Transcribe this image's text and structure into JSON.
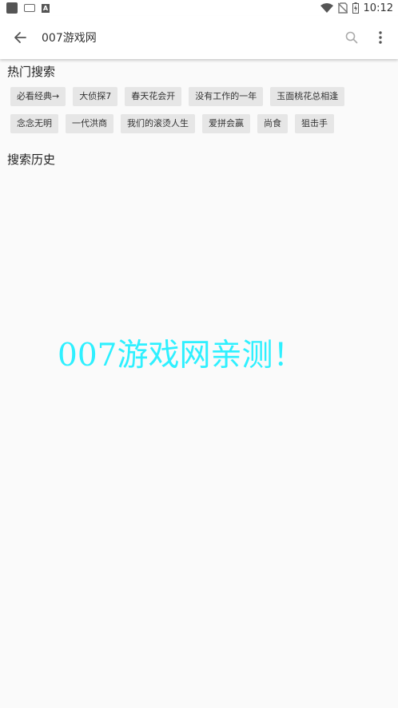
{
  "status_bar": {
    "time": "10:12",
    "notif_letter": "A"
  },
  "search": {
    "query": "007游戏网"
  },
  "hot_search": {
    "title": "热门搜索",
    "items": [
      "必看经典→",
      "大侦探7",
      "春天花会开",
      "没有工作的一年",
      "玉面桃花总相逢",
      "念念无明",
      "一代洪商",
      "我们的滚烫人生",
      "爱拼会赢",
      "尚食",
      "狙击手"
    ]
  },
  "history": {
    "title": "搜索历史"
  },
  "watermark": {
    "text": "007游戏网亲测！"
  },
  "colors": {
    "watermark": "#2ef0ff",
    "chip_bg": "#e6e6e6",
    "background": "#fafafa"
  }
}
